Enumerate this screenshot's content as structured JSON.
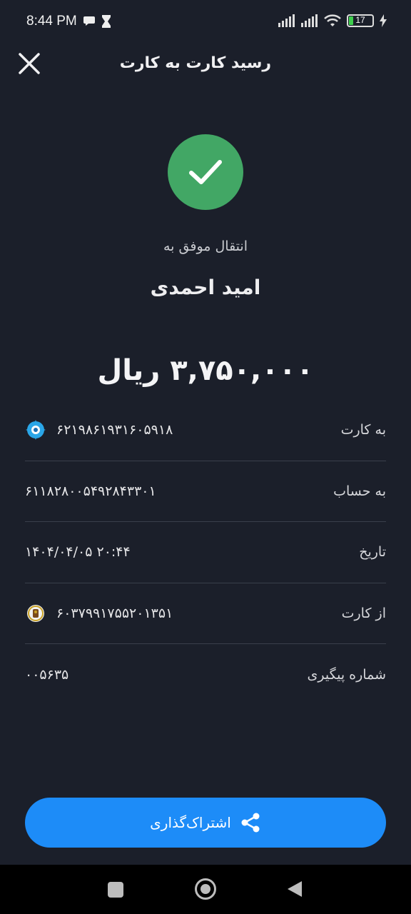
{
  "status": {
    "time": "8:44 PM",
    "battery": "17"
  },
  "header": {
    "title": "رسید کارت به کارت"
  },
  "receipt": {
    "success_text": "انتقال موفق به",
    "recipient": "امید احمدی",
    "amount": "۳,۷۵۰,۰۰۰ ریال",
    "rows": [
      {
        "label": "به کارت",
        "value": "۶۲۱۹۸۶۱۹۳۱۶۰۵۹۱۸"
      },
      {
        "label": "به حساب",
        "value": "۶۱۱۸۲۸۰۰۵۴۹۲۸۴۳۳۰۱"
      },
      {
        "label": "تاریخ",
        "value": "۱۴۰۴/۰۴/۰۵  ۲۰:۴۴"
      },
      {
        "label": "از کارت",
        "value": "۶۰۳۷۹۹۱۷۵۵۲۰۱۳۵۱"
      },
      {
        "label": "شماره پیگیری",
        "value": "۰۰۵۶۳۵"
      }
    ]
  },
  "share": {
    "label": "اشتراک‌گذاری"
  },
  "colors": {
    "background": "#1b1f2a",
    "success": "#42a765",
    "accent": "#1d8cf8"
  }
}
